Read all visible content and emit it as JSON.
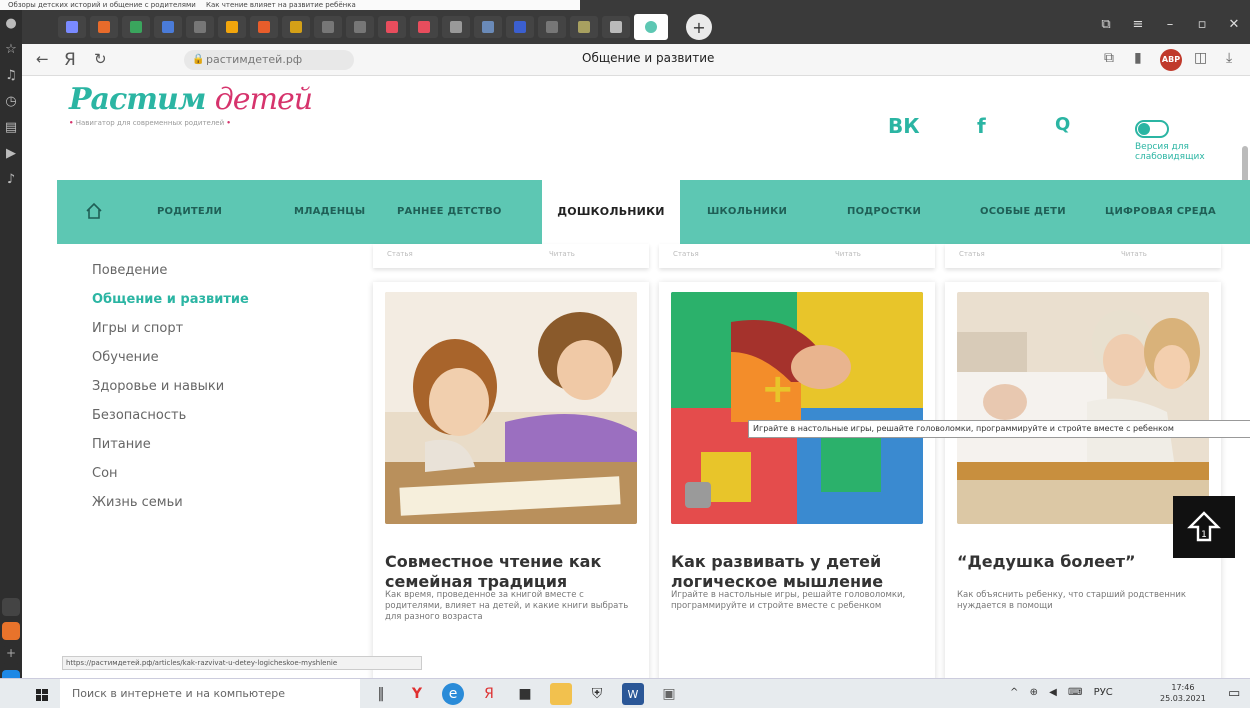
{
  "tabstrip": {
    "peek_texts": [
      "Обзоры детских историй и общение с родителями",
      "Как чтение влияет на развитие ребёнка"
    ]
  },
  "address_bar": {
    "back_icon": "arrow-left-icon",
    "yandex_icon": "Я",
    "reload_icon": "reload-icon",
    "url": "растимдетей.рф",
    "page_title": "Общение и развитие"
  },
  "header": {
    "logo_main": "Растим",
    "logo_script": "детей",
    "tagline": "Навигатор для современных родителей",
    "icons": [
      "vk-icon",
      "facebook-icon",
      "search-icon"
    ],
    "vk_text": "ВК",
    "fb_text": "f",
    "search_text": "Q",
    "vision_toggle_label": "Версия для слабовидящих"
  },
  "nav": {
    "home_icon": "home-icon",
    "items": [
      {
        "label": "РОДИТЕЛИ"
      },
      {
        "label": "МЛАДЕНЦЫ"
      },
      {
        "label": "РАННЕЕ ДЕТСТВО"
      },
      {
        "label": "ДОШКОЛЬНИКИ"
      },
      {
        "label": "ШКОЛЬНИКИ"
      },
      {
        "label": "ПОДРОСТКИ"
      },
      {
        "label": "ОСОБЫЕ ДЕТИ"
      },
      {
        "label": "ЦИФРОВАЯ СРЕДА"
      }
    ],
    "active_index": 3
  },
  "sidebar_menu": {
    "items": [
      {
        "label": "Поведение"
      },
      {
        "label": "Общение и развитие"
      },
      {
        "label": "Игры и спорт"
      },
      {
        "label": "Обучение"
      },
      {
        "label": "Здоровье и навыки"
      },
      {
        "label": "Безопасность"
      },
      {
        "label": "Питание"
      },
      {
        "label": "Сон"
      },
      {
        "label": "Жизнь семьи"
      }
    ],
    "active_index": 1
  },
  "cards": [
    {
      "title": "Совместное чтение как семейная традиция",
      "text": "Как время, проведенное за книгой вместе с родителями, влияет на детей, и какие книги выбрать для разного возраста"
    },
    {
      "title": "Как развивать у детей логическое мышление",
      "text": "Играйте в настольные игры, решайте головоломки, программируйте и стройте вместе с ребенком"
    },
    {
      "title": "“Дедушка болеет”",
      "text": "Как объяснить ребенку, что старший родственник нуждается в помощи"
    }
  ],
  "card_top_meta": {
    "left": "Статья",
    "right": "Читать"
  },
  "tooltip": "Играйте в настольные игры, решайте головоломки, программируйте и стройте вместе с ребенком",
  "status_url": "https://растимдетей.рф/articles/kak-razvivat-u-detey-logicheskoe-myshlenie",
  "taskbar": {
    "search_placeholder": "Поиск в интернете и на компьютере",
    "lang": "РУС",
    "time": "17:46",
    "date": "25.03.2021"
  },
  "colors": {
    "accent": "#5dc7b3",
    "brand_teal": "#2bb5a3",
    "brand_pink": "#d6336c"
  }
}
